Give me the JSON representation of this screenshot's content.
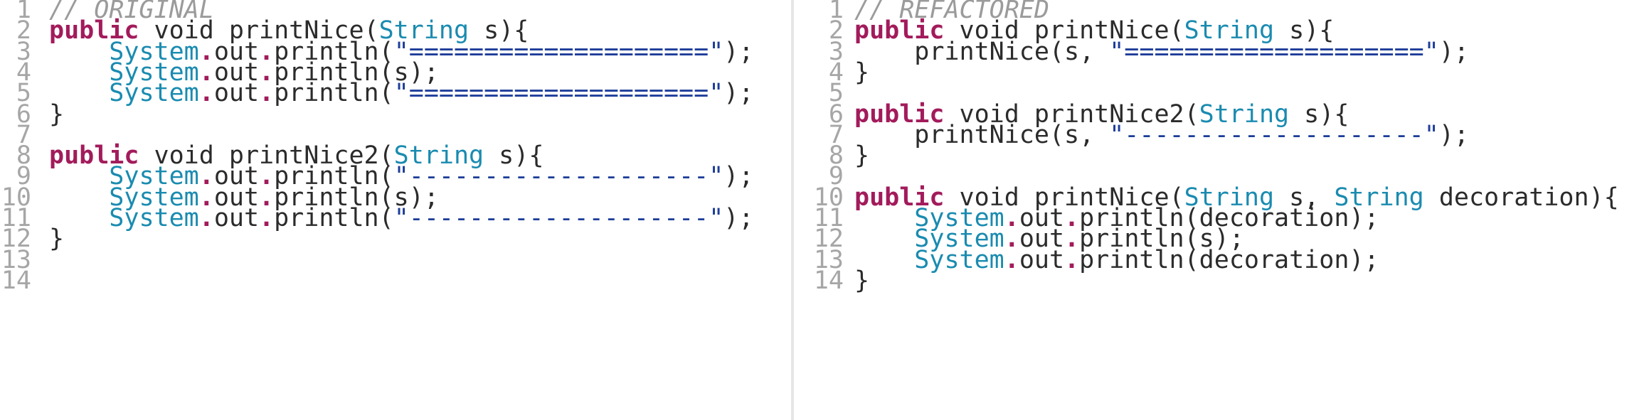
{
  "colors": {
    "keyword": "#a21b5b",
    "type": "#1a8bb0",
    "string": "#1d3d99",
    "comment": "#9b9b9b",
    "plain": "#2b2b2b",
    "line_number": "#a6a6a6",
    "change_marker": "#4caf50"
  },
  "fold_icon": "triangle-down-icon",
  "panes": [
    {
      "name": "original",
      "lines": [
        {
          "n": "1",
          "fold": "",
          "tokens": [
            {
              "t": "cmt",
              "v": "// ORIGINAL"
            }
          ]
        },
        {
          "n": "2",
          "fold": "▾",
          "tokens": [
            {
              "t": "kw",
              "v": "public"
            },
            {
              "t": "pln",
              "v": " void printNice("
            },
            {
              "t": "typ",
              "v": "String"
            },
            {
              "t": "pln",
              "v": " s){"
            }
          ]
        },
        {
          "n": "3",
          "fold": "",
          "tokens": [
            {
              "t": "pln",
              "v": "    "
            },
            {
              "t": "typ",
              "v": "System"
            },
            {
              "t": "dot",
              "v": "."
            },
            {
              "t": "pln",
              "v": "out"
            },
            {
              "t": "dot",
              "v": "."
            },
            {
              "t": "pln",
              "v": "println("
            },
            {
              "t": "str",
              "v": "\"====================\""
            },
            {
              "t": "pln",
              "v": ");"
            }
          ]
        },
        {
          "n": "4",
          "fold": "",
          "tokens": [
            {
              "t": "pln",
              "v": "    "
            },
            {
              "t": "typ",
              "v": "System"
            },
            {
              "t": "dot",
              "v": "."
            },
            {
              "t": "pln",
              "v": "out"
            },
            {
              "t": "dot",
              "v": "."
            },
            {
              "t": "pln",
              "v": "println(s);"
            }
          ]
        },
        {
          "n": "5",
          "fold": "",
          "tokens": [
            {
              "t": "pln",
              "v": "    "
            },
            {
              "t": "typ",
              "v": "System"
            },
            {
              "t": "dot",
              "v": "."
            },
            {
              "t": "pln",
              "v": "out"
            },
            {
              "t": "dot",
              "v": "."
            },
            {
              "t": "pln",
              "v": "println("
            },
            {
              "t": "str",
              "v": "\"====================\""
            },
            {
              "t": "pln",
              "v": ");"
            }
          ]
        },
        {
          "n": "6",
          "fold": "",
          "tokens": [
            {
              "t": "pln",
              "v": "}"
            }
          ]
        },
        {
          "n": "7",
          "fold": "",
          "tokens": []
        },
        {
          "n": "8",
          "fold": "▾",
          "tokens": [
            {
              "t": "kw",
              "v": "public"
            },
            {
              "t": "pln",
              "v": " void printNice2("
            },
            {
              "t": "typ",
              "v": "String"
            },
            {
              "t": "pln",
              "v": " s){"
            }
          ]
        },
        {
          "n": "9",
          "fold": "",
          "tokens": [
            {
              "t": "pln",
              "v": "    "
            },
            {
              "t": "typ",
              "v": "System"
            },
            {
              "t": "dot",
              "v": "."
            },
            {
              "t": "pln",
              "v": "out"
            },
            {
              "t": "dot",
              "v": "."
            },
            {
              "t": "pln",
              "v": "println("
            },
            {
              "t": "str",
              "v": "\"--------------------\""
            },
            {
              "t": "pln",
              "v": ");"
            }
          ]
        },
        {
          "n": "10",
          "fold": "",
          "tokens": [
            {
              "t": "pln",
              "v": "    "
            },
            {
              "t": "typ",
              "v": "System"
            },
            {
              "t": "dot",
              "v": "."
            },
            {
              "t": "pln",
              "v": "out"
            },
            {
              "t": "dot",
              "v": "."
            },
            {
              "t": "pln",
              "v": "println(s);"
            }
          ]
        },
        {
          "n": "11",
          "fold": "",
          "tokens": [
            {
              "t": "pln",
              "v": "    "
            },
            {
              "t": "typ",
              "v": "System"
            },
            {
              "t": "dot",
              "v": "."
            },
            {
              "t": "pln",
              "v": "out"
            },
            {
              "t": "dot",
              "v": "."
            },
            {
              "t": "pln",
              "v": "println("
            },
            {
              "t": "str",
              "v": "\"--------------------\""
            },
            {
              "t": "pln",
              "v": ");"
            }
          ]
        },
        {
          "n": "12",
          "fold": "",
          "tokens": [
            {
              "t": "pln",
              "v": "}"
            }
          ]
        },
        {
          "n": "13",
          "fold": "",
          "tokens": []
        },
        {
          "n": "14",
          "fold": "",
          "tokens": []
        }
      ]
    },
    {
      "name": "refactored",
      "lines": [
        {
          "n": "1",
          "fold": "",
          "tokens": [
            {
              "t": "cmt",
              "v": "// REFACTORED"
            }
          ]
        },
        {
          "n": "2",
          "fold": "",
          "tokens": [
            {
              "t": "kw",
              "v": "public"
            },
            {
              "t": "pln",
              "v": " void printNice("
            },
            {
              "t": "typ",
              "v": "String"
            },
            {
              "t": "pln",
              "v": " s){"
            }
          ]
        },
        {
          "n": "3",
          "fold": "",
          "tokens": [
            {
              "t": "pln",
              "v": "    printNice(s, "
            },
            {
              "t": "str",
              "v": "\"====================\""
            },
            {
              "t": "pln",
              "v": ");"
            }
          ]
        },
        {
          "n": "4",
          "fold": "",
          "tokens": [
            {
              "t": "pln",
              "v": "}"
            }
          ]
        },
        {
          "n": "5",
          "fold": "",
          "tokens": []
        },
        {
          "n": "6",
          "fold": "",
          "tokens": [
            {
              "t": "kw",
              "v": "public"
            },
            {
              "t": "pln",
              "v": " void printNice2("
            },
            {
              "t": "typ",
              "v": "String"
            },
            {
              "t": "pln",
              "v": " s){"
            }
          ]
        },
        {
          "n": "7",
          "fold": "",
          "tokens": [
            {
              "t": "pln",
              "v": "    printNice(s, "
            },
            {
              "t": "str",
              "v": "\"--------------------\""
            },
            {
              "t": "pln",
              "v": ");"
            }
          ]
        },
        {
          "n": "8",
          "fold": "",
          "tokens": [
            {
              "t": "pln",
              "v": "}"
            }
          ]
        },
        {
          "n": "9",
          "fold": "",
          "tokens": []
        },
        {
          "n": "10",
          "fold": "",
          "tokens": [
            {
              "t": "kw",
              "v": "public"
            },
            {
              "t": "pln",
              "v": " void printNice("
            },
            {
              "t": "typ",
              "v": "String"
            },
            {
              "t": "pln",
              "v": " s, "
            },
            {
              "t": "typ",
              "v": "String"
            },
            {
              "t": "pln",
              "v": " decoration){"
            }
          ]
        },
        {
          "n": "11",
          "fold": "",
          "tokens": [
            {
              "t": "pln",
              "v": "    "
            },
            {
              "t": "typ",
              "v": "System"
            },
            {
              "t": "dot",
              "v": "."
            },
            {
              "t": "pln",
              "v": "out"
            },
            {
              "t": "dot",
              "v": "."
            },
            {
              "t": "pln",
              "v": "println(decoration);"
            }
          ]
        },
        {
          "n": "12",
          "fold": "",
          "tokens": [
            {
              "t": "pln",
              "v": "    "
            },
            {
              "t": "typ",
              "v": "System"
            },
            {
              "t": "dot",
              "v": "."
            },
            {
              "t": "pln",
              "v": "out"
            },
            {
              "t": "dot",
              "v": "."
            },
            {
              "t": "pln",
              "v": "println(s);"
            }
          ]
        },
        {
          "n": "13",
          "fold": "",
          "tokens": [
            {
              "t": "pln",
              "v": "    "
            },
            {
              "t": "typ",
              "v": "System"
            },
            {
              "t": "dot",
              "v": "."
            },
            {
              "t": "pln",
              "v": "out"
            },
            {
              "t": "dot",
              "v": "."
            },
            {
              "t": "pln",
              "v": "println(decoration);"
            }
          ]
        },
        {
          "n": "14",
          "fold": "",
          "tokens": [
            {
              "t": "pln",
              "v": "}"
            }
          ]
        }
      ]
    }
  ]
}
